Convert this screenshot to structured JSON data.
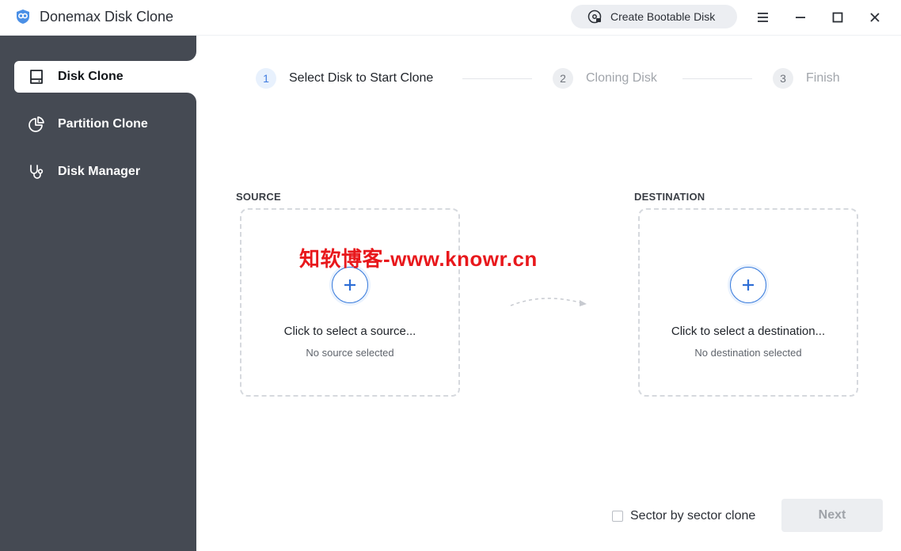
{
  "window": {
    "title": "Donemax Disk Clone",
    "bootable_button": "Create Bootable Disk",
    "controls": [
      "menu-icon",
      "minimize-icon",
      "maximize-icon",
      "close-icon"
    ]
  },
  "sidebar": {
    "items": [
      {
        "label": "Disk Clone",
        "icon": "hard-drive-icon",
        "active": true
      },
      {
        "label": "Partition Clone",
        "icon": "pie-chart-icon",
        "active": false
      },
      {
        "label": "Disk Manager",
        "icon": "stethoscope-icon",
        "active": false
      }
    ]
  },
  "steps": [
    {
      "num": "1",
      "label": "Select Disk to Start Clone",
      "state": "current"
    },
    {
      "num": "2",
      "label": "Cloning Disk",
      "state": "pending"
    },
    {
      "num": "3",
      "label": "Finish",
      "state": "pending"
    }
  ],
  "source": {
    "title": "SOURCE",
    "main": "Click to select a source...",
    "sub": "No source selected"
  },
  "destination": {
    "title": "DESTINATION",
    "main": "Click to select a destination...",
    "sub": "No destination selected"
  },
  "watermark": "知软博客-www.knowr.cn",
  "footer": {
    "sector_label": "Sector by sector clone",
    "sector_checked": false,
    "next_label": "Next",
    "next_enabled": false
  },
  "colors": {
    "sidebar_bg": "#454a53",
    "accent": "#3b7ddd",
    "watermark": "#e8181c"
  }
}
